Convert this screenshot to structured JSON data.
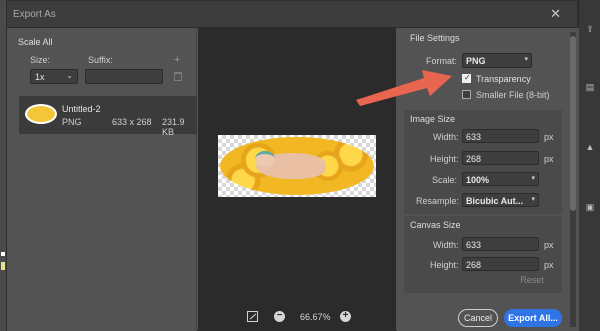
{
  "dialog": {
    "title": "Export As",
    "close_glyph": "✕"
  },
  "left": {
    "section_title": "Scale All",
    "size_label": "Size:",
    "suffix_label": "Suffix:",
    "scale_value": "1x",
    "suffix_value": "",
    "add_glyph": "+",
    "asset": {
      "name": "Untitled-2",
      "format": "PNG",
      "dimensions": "633 x 268",
      "filesize": "231.9 KB"
    }
  },
  "preview": {
    "zoom": "66.67%"
  },
  "file_settings": {
    "title": "File Settings",
    "format_label": "Format:",
    "format_value": "PNG",
    "transparency_label": "Transparency",
    "transparency_checked": true,
    "smaller_file_label": "Smaller File (8-bit)",
    "smaller_file_checked": false
  },
  "image_size": {
    "title": "Image Size",
    "width_label": "Width:",
    "width_value": "633",
    "width_unit": "px",
    "height_label": "Height:",
    "height_value": "268",
    "height_unit": "px",
    "scale_label": "Scale:",
    "scale_value": "100%",
    "resample_label": "Resample:",
    "resample_value": "Bicubic Aut..."
  },
  "canvas_size": {
    "title": "Canvas Size",
    "width_label": "Width:",
    "width_value": "633",
    "width_unit": "px",
    "height_label": "Height:",
    "height_value": "268",
    "height_unit": "px",
    "reset_label": "Reset"
  },
  "buttons": {
    "cancel": "Cancel",
    "export": "Export All..."
  },
  "colors": {
    "accent": "#2f74e5",
    "arrow": "#e8654f"
  }
}
